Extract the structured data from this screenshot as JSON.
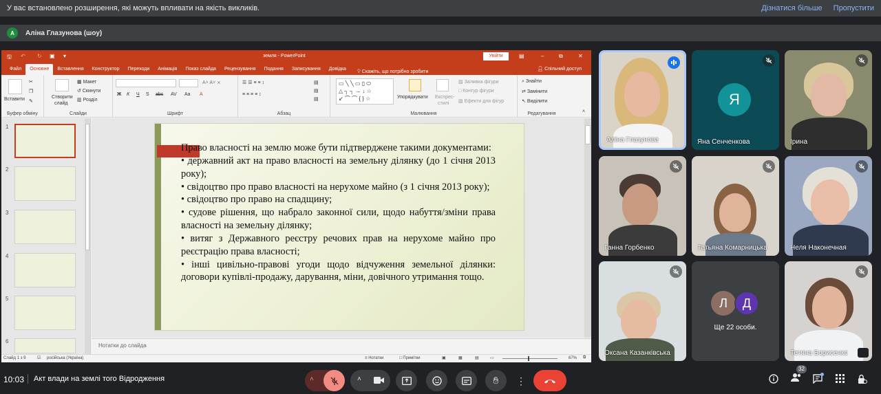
{
  "notification": {
    "message": "У вас встановлено розширення, які можуть впливати на якість викликів.",
    "learn_more": "Дізнатися більше",
    "skip": "Пропустити"
  },
  "presenter": {
    "avatar_letter": "А",
    "label": "Аліна Глазунова (шоу)"
  },
  "ppt": {
    "title": "земля - PowerPoint",
    "signin": "Увійти",
    "menu": [
      "Файл",
      "Основне",
      "Вставлення",
      "Конструктор",
      "Переходи",
      "Анімація",
      "Показ слайда",
      "Рецензування",
      "Подання",
      "Записування",
      "Довідка"
    ],
    "active_tab": "Основне",
    "tell_me": "Скажіть, що потрібно зробити",
    "share": "Спільний доступ",
    "ribbon": {
      "paste": "Вставити",
      "clipboard": "Буфер обміну",
      "new_slide_1": "Створити",
      "new_slide_2": "слайд",
      "layout": "Макет",
      "reset": "Скинути",
      "section": "Розділ",
      "slides": "Слайди",
      "font": "Шрифт",
      "paragraph": "Абзац",
      "arrange_1": "Упорядкувати",
      "quick_styles_1": "Експрес-",
      "quick_styles_2": "стилі",
      "shape_fill": "Заливка фігури",
      "shape_outline": "Контур фігури",
      "shape_effects": "Ефекти для фігур",
      "drawing": "Малювання",
      "find": "Знайти",
      "replace": "Замінити",
      "select": "Виділити",
      "editing": "Редагування"
    },
    "thumb_numbers": [
      "1",
      "2",
      "3",
      "4",
      "5",
      "6"
    ],
    "slide_lines": [
      "Право власності на землю може бути підтверджене такими документами:",
      "•   державний акт на право власності на земельну ділянку (до 1 січня 2013 року);",
      "•   свідоцтво про право власності на нерухоме майно (з 1 січня 2013 року);",
      "•   свідоцтво про право на спадщину;",
      "•   судове рішення, що набрало законної сили, щодо набуття/зміни права власності на земельну ділянку;",
      "•   витяг з Державного реєстру речових прав на нерухоме майно про реєстрацію права власності;",
      "•   інші цивільно-правові угоди щодо відчуження земельної ділянки: договори купівлі-продажу, дарування, міни, довічного утримання тощо."
    ],
    "notes_placeholder": "Нотатки до слайда",
    "status": {
      "slide_count": "Слайд 1 з 9",
      "language": "російська (Україна)",
      "notes": "Нотатки",
      "comments": "Примітки",
      "zoom": "67%"
    }
  },
  "participants": [
    {
      "name": "Аліна Глазунова",
      "speaking": true
    },
    {
      "name": "Яна Сенченкова",
      "avatar_letter": "Я",
      "avatar_color": "#12939a"
    },
    {
      "name": "Ірина"
    },
    {
      "name": "Ганна Горбенко"
    },
    {
      "name": "Татьяна Комарницька"
    },
    {
      "name": "Неля Наконечная"
    },
    {
      "name": "Оксана Казанківська"
    },
    {
      "name": "Ще 22 особи.",
      "avatars": [
        "Л",
        "Д"
      ]
    },
    {
      "name": "Тетяна Борисенко"
    }
  ],
  "bottom_bar": {
    "time": "10:03",
    "meeting_title": "Акт влади на землі того Відродження",
    "people_count": "32"
  },
  "colors": {
    "ppt_accent": "#c43e1c",
    "hangup": "#ea4335",
    "mic_off": "#f28b82",
    "link": "#8ab4f8"
  }
}
